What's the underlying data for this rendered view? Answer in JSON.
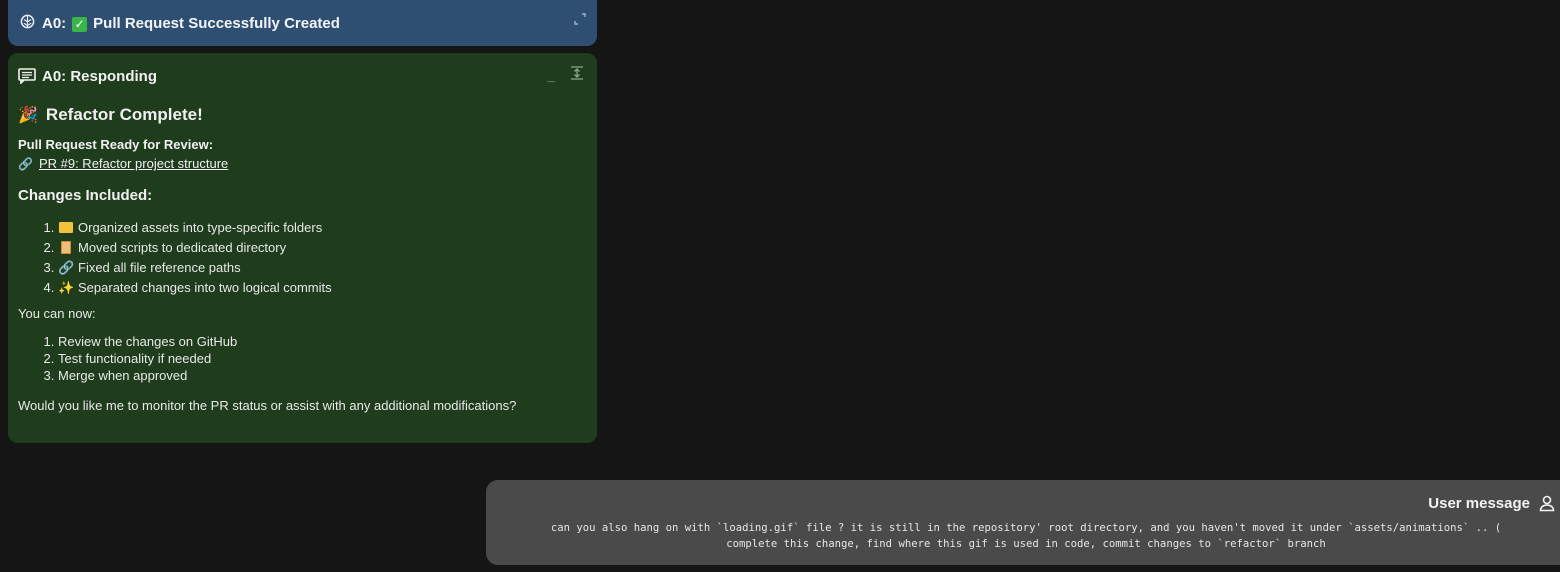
{
  "top_message": {
    "title": "A0: ",
    "title_rest": "Pull Request Successfully Created",
    "icon": "brain-icon",
    "status_icon": "check-icon"
  },
  "responding": {
    "header": "A0: Responding",
    "heading": "Refactor Complete!",
    "pr_ready_label": "Pull Request Ready for Review:",
    "pr_link": "PR #9: Refactor project structure",
    "changes_heading": "Changes Included:",
    "changes": [
      "Organized assets into type-specific folders",
      "Moved scripts to dedicated directory",
      "Fixed all file reference paths",
      "Separated changes into two logical commits"
    ],
    "you_can": "You can now:",
    "steps": [
      "Review the changes on GitHub",
      "Test functionality if needed",
      "Merge when approved"
    ],
    "closing": "Would you like me to monitor the PR status or assist with any additional modifications?"
  },
  "user_message": {
    "label": "User message",
    "line1": "can you also hang on with `loading.gif` file ? it is still in the repository' root directory, and you haven't moved it under `assets/animations` .. (",
    "line2": "complete this change, find where this gif is used in code, commit changes to `refactor` branch"
  },
  "colors": {
    "background": "#151515",
    "top_panel": "#2f4f72",
    "responding_panel": "#1f3d1d",
    "user_panel": "#4a4a4a",
    "check": "#3ab54a"
  }
}
